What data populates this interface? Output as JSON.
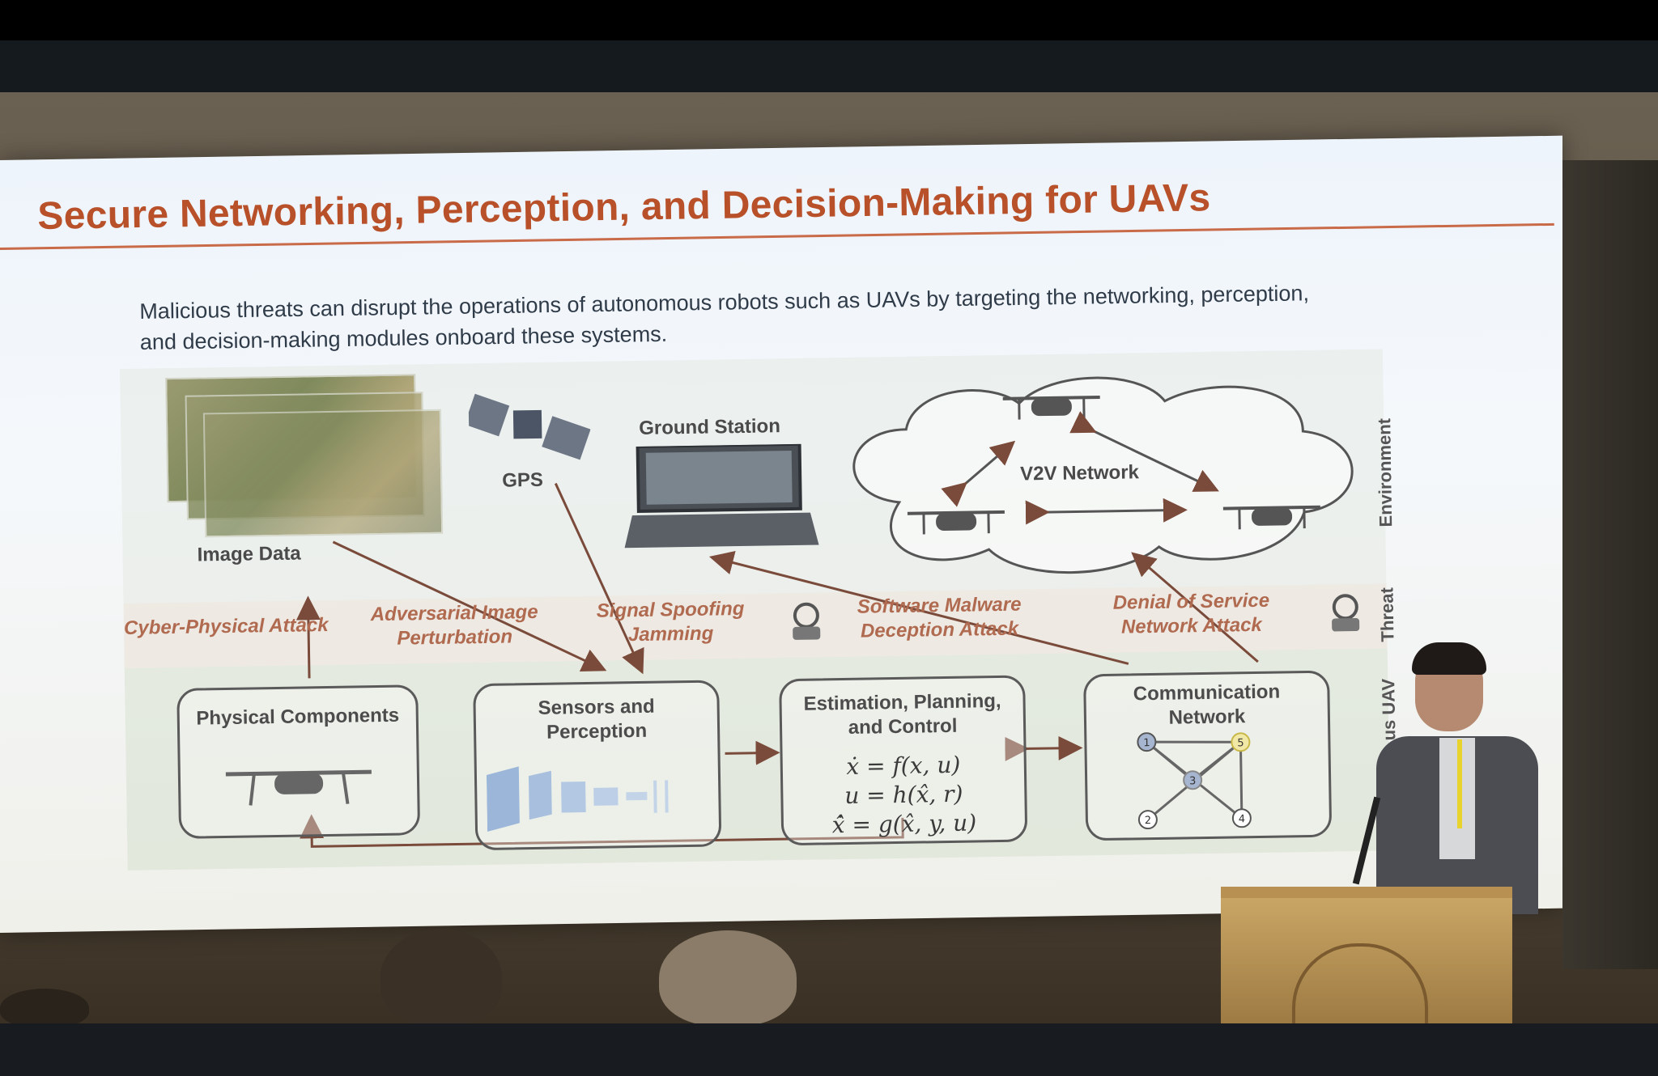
{
  "slide": {
    "title": "Secure Networking, Perception, and Decision-Making for UAVs",
    "subtitle": "Malicious threats can disrupt the operations of autonomous robots such as UAVs by targeting the networking, perception, and decision-making modules onboard these systems."
  },
  "diagram": {
    "environment": {
      "image_data": "Image Data",
      "gps": "GPS",
      "ground_station": "Ground Station",
      "v2v_network": "V2V Network"
    },
    "threats": {
      "t1": "Cyber-Physical Attack",
      "t2a": "Adversarial Image",
      "t2b": "Perturbation",
      "t3a": "Signal Spoofing",
      "t3b": "Jamming",
      "t4a": "Software Malware",
      "t4b": "Deception Attack",
      "t5a": "Denial of Service",
      "t5b": "Network Attack"
    },
    "uav": {
      "physical": "Physical Components",
      "sensors_a": "Sensors and",
      "sensors_b": "Perception",
      "est_a": "Estimation, Planning,",
      "est_b": "and Control",
      "eq1": "ẋ = f(x, u)",
      "eq2": "u = h(x̂, r)",
      "eq3": "x̂̇ = g(x̂, y, u)",
      "comm_a": "Communication",
      "comm_b": "Network",
      "node1": "1",
      "node2": "2",
      "node3": "3",
      "node4": "4",
      "node5": "5"
    },
    "side_labels": {
      "environment": "Environment",
      "threat": "Threat",
      "uav": "us UAV"
    }
  },
  "colors": {
    "title": "#b8502a",
    "threat_text": "#b06a50",
    "arrow": "#7a4a3a"
  }
}
